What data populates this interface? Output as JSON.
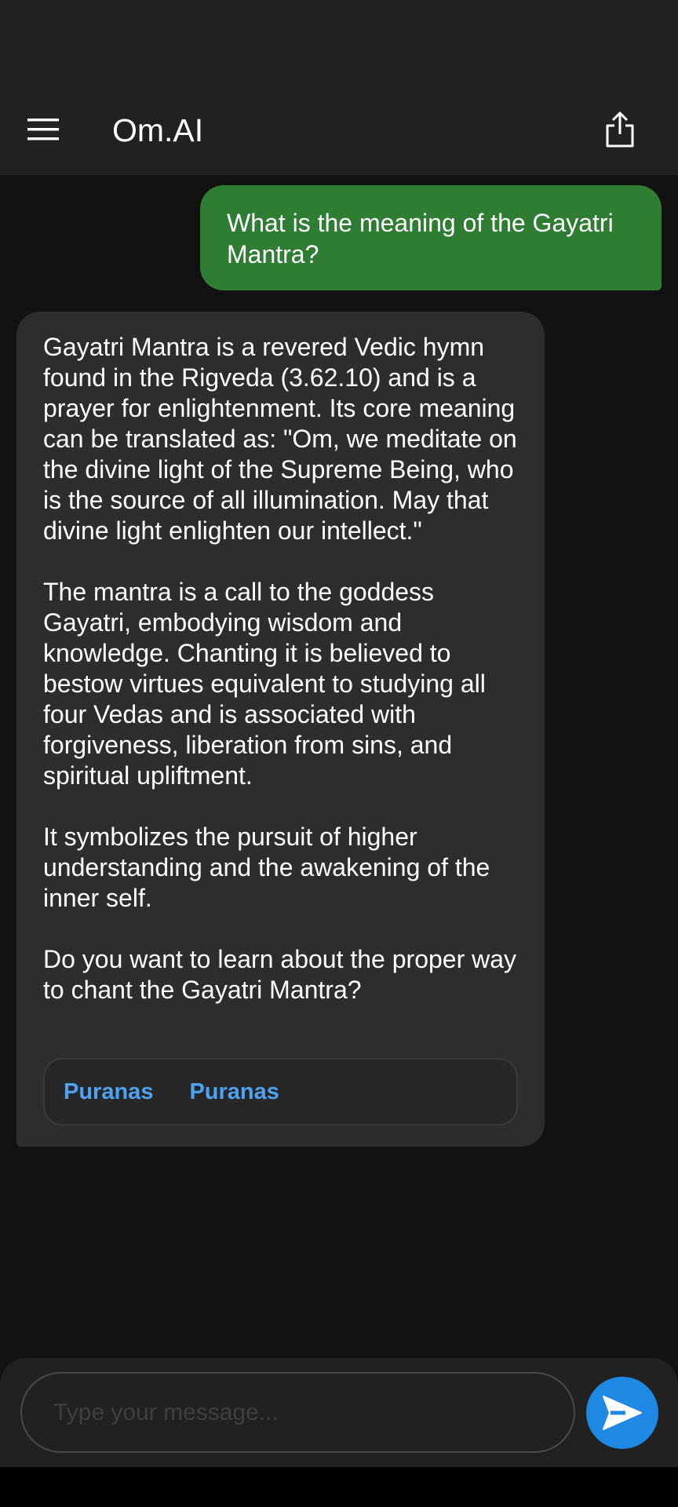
{
  "app_bar": {
    "title": "Om.AI",
    "menu_icon": "hamburger-menu-icon",
    "share_icon": "share-icon"
  },
  "chat": {
    "user_message": "What is the meaning of the Gayatri Mantra?",
    "bot_paragraphs": [
      "Gayatri Mantra is a revered Vedic hymn found in the Rigveda (3.62.10) and is a prayer for enlightenment. Its core meaning can be translated as: \"Om, we meditate on the divine light of the Supreme Being, who is the source of all illumination. May that divine light enlighten our intellect.\"",
      "The mantra is a call to the goddess Gayatri, embodying wisdom and knowledge. Chanting it is believed to bestow virtues equivalent to studying all four Vedas and is associated with forgiveness, liberation from sins, and spiritual upliftment.",
      "It symbolizes the pursuit of higher understanding and the awakening of the inner self.",
      "Do you want to learn about the proper way to chant the Gayatri Mantra?"
    ],
    "chips": [
      "Puranas",
      "Puranas"
    ]
  },
  "composer": {
    "placeholder": "Type your message...",
    "send_icon": "send-icon"
  },
  "colors": {
    "background": "#121212",
    "app_bar": "#212121",
    "user_bubble": "#2e7d32",
    "bot_bubble": "#2d2d2d",
    "chip_text": "#4da3f2",
    "send_button": "#1e88e5"
  }
}
